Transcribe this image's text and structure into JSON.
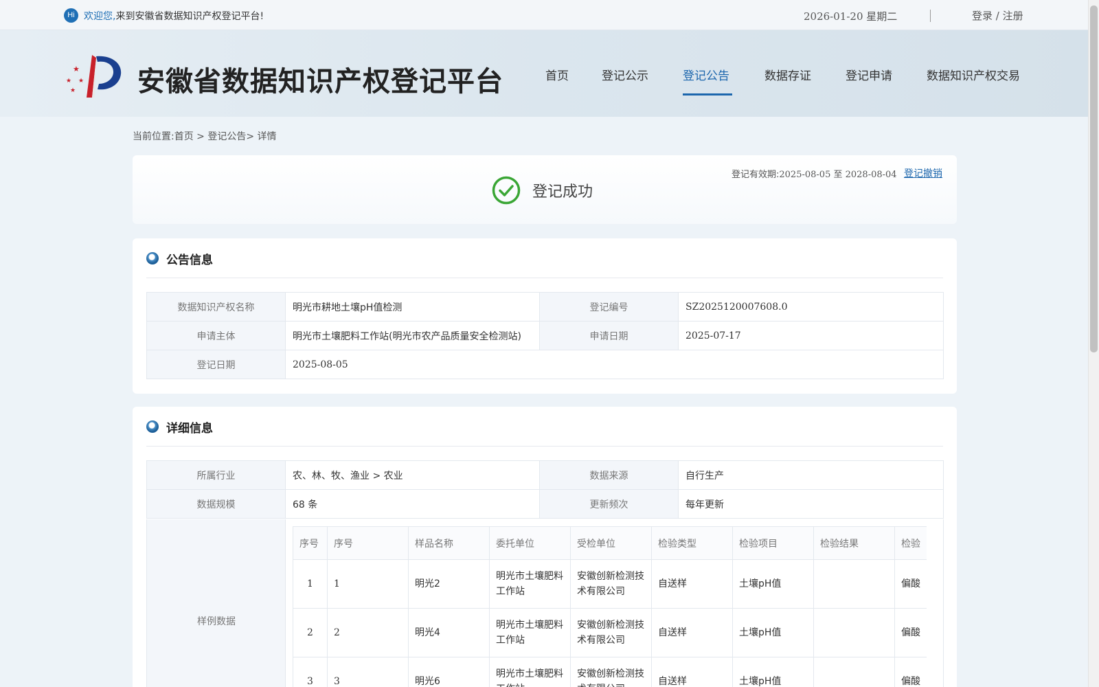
{
  "topbar": {
    "welcome_hl": "欢迎您,",
    "welcome_rest": "来到安徽省数据知识产权登记平台!",
    "hi": "Hi",
    "date": "2026-01-20 星期二",
    "login": "登录",
    "slash": " / ",
    "register": "注册"
  },
  "header": {
    "title": "安徽省数据知识产权登记平台",
    "nav": [
      "首页",
      "登记公示",
      "登记公告",
      "数据存证",
      "登记申请",
      "数据知识产权交易"
    ],
    "active_nav": "登记公告"
  },
  "breadcrumb": {
    "prefix": "当前位置:",
    "home": "首页",
    "sep1": " > ",
    "section": "登记公告",
    "sep2": "> ",
    "current": "详情"
  },
  "status": {
    "text": "登记成功",
    "validity_label": "登记有效期:",
    "validity_value": "2025-08-05 至 2028-08-04",
    "revoke": "登记撤销"
  },
  "announce": {
    "heading": "公告信息",
    "rows": [
      {
        "k1": "数据知识产权名称",
        "v1": "明光市耕地土壤pH值检测",
        "k2": "登记编号",
        "v2": "SZ2025120007608.0"
      },
      {
        "k1": "申请主体",
        "v1": "明光市土壤肥料工作站(明光市农产品质量安全检测站)",
        "k2": "申请日期",
        "v2": "2025-07-17"
      },
      {
        "k1": "登记日期",
        "v1": "2025-08-05"
      }
    ]
  },
  "detail": {
    "heading": "详细信息",
    "rows": [
      {
        "k1": "所属行业",
        "v1": "农、林、牧、渔业 > 农业",
        "k2": "数据来源",
        "v2": "自行生产"
      },
      {
        "k1": "数据规模",
        "v1": "68 条",
        "k2": "更新频次",
        "v2": "每年更新"
      }
    ],
    "sample_label": "样例数据",
    "sample_headers": [
      "序号",
      "序号",
      "样品名称",
      "委托单位",
      "受检单位",
      "检验类型",
      "检验项目",
      "检验结果",
      "检验"
    ],
    "sample_rows": [
      [
        "1",
        "1",
        "明光2",
        "明光市土壤肥料工作站",
        "安徽创新检测技术有限公司",
        "自送样",
        "土壤pH值",
        "",
        "偏酸"
      ],
      [
        "2",
        "2",
        "明光4",
        "明光市土壤肥料工作站",
        "安徽创新检测技术有限公司",
        "自送样",
        "土壤pH值",
        "",
        "偏酸"
      ],
      [
        "3",
        "3",
        "明光6",
        "明光市土壤肥料工作站",
        "安徽创新检测技术有限公司",
        "自送样",
        "土壤pH值",
        "",
        "偏酸"
      ]
    ]
  },
  "colors": {
    "accent": "#1c66ad",
    "success": "#3aa635"
  }
}
